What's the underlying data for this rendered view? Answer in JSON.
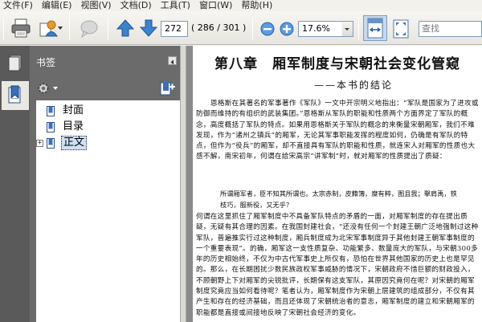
{
  "menu": {
    "items": [
      "文件(F)",
      "编辑(E)",
      "视图(V)",
      "文档(D)",
      "工具(T)",
      "窗口(W)",
      "帮助(H)"
    ]
  },
  "toolbar": {
    "current_page": "272",
    "page_count": "( 286 / 301 )",
    "zoom": "17.6%",
    "search_placeholder": "查找"
  },
  "bookmarks": {
    "title": "书签",
    "items": [
      {
        "label": "封面",
        "expandable": false,
        "selected": false
      },
      {
        "label": "目录",
        "expandable": false,
        "selected": false
      },
      {
        "label": "正文",
        "expandable": true,
        "selected": true
      }
    ]
  },
  "document": {
    "chapter_title": "第八章　厢军制度与宋朝社会变化管窥",
    "chapter_subtitle": "——本书的结论",
    "para1": "恩格斯在其著名的军事著作《军队》一文中开宗明义地指出：“军队是国家为了进攻或防御而维持的有组织的武装集团。”恩格斯从军队的职能和性质两个方面界定了军队的概念，高度概括了军队的特点。如果用恩格斯关于军队的概念的来衡量宋朝厢军，我们不难发现，作为“诸州之镇兵”的厢军，无论其军事职能发挥的程度如何，仍确是有军队的特点，但作为“役兵”的厢军，却不直接具有军队的职能和性质，就连宋人对厢军的性质也大感不解，南宋初年，何谓在给宋高宗“讲军制”时，就对厢军的性质提出了质疑：",
    "quote": "所谓厢军者，臣不知其所谓也。太宗赤制，皮籍簿，糜有粹，图且我；擊肩禹，铁枝巧，服新役，又无乎？",
    "para2": "何谓在这里抓住了厢军制度中不具备军队特点的矛盾的一面，对厢军制度的存在提出质疑，无疑有其合理的因素。在我国封建社会，“还没有任何一个封建王朝广泛地强制过这种军队，普遍推实行过这种制度，厢兵制度成为北宋军事制度异于其他封建王朝军事制度的一个重要表现”。的确，厢军这一支性质复杂、功能繁多、数量庞大的军队，与宋朝300多年的历史相始终，不仅为中古代军事史上所仅有，恐怕在世界其他国家的历史上也是罕见的。那么，在长期困扰少数民族政权军事威胁的情况下，宋朝政府不惜巨额的财政投入，不顾朝野上下对厢军的尖锐批评，长期保有这支军队，其原因究竟何在呢？对宋朝的厢军制度究竟应当如何看待呢？笔者认为，厢军制度作为宋朝上层建筑的组成部分，不仅有其产生和存在的经济基础，而且还体现了宋朝统治者的意志，厢军制度的建立和宋朝厢军的职能都是直接或间接地反映了宋朝社会经济的变化。"
  }
}
